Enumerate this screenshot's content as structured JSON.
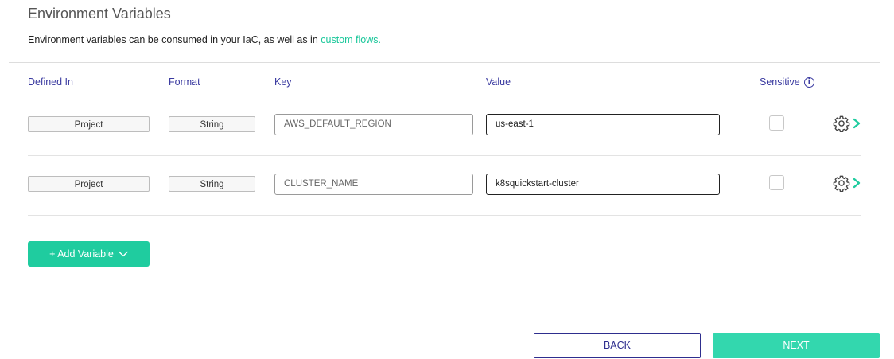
{
  "section": {
    "title": "Environment Variables",
    "description": "Environment variables can be consumed in your IaC, as well as in",
    "link_text": "custom flows."
  },
  "table": {
    "headers": {
      "defined_in": "Defined In",
      "format": "Format",
      "key": "Key",
      "value": "Value",
      "sensitive": "Sensitive"
    },
    "rows": [
      {
        "defined_in": "Project",
        "format": "String",
        "key": "AWS_DEFAULT_REGION",
        "value": "us-east-1",
        "sensitive": false
      },
      {
        "defined_in": "Project",
        "format": "String",
        "key": "CLUSTER_NAME",
        "value": "k8squickstart-cluster",
        "sensitive": false
      }
    ]
  },
  "actions": {
    "add_variable": "+ Add Variable",
    "back": "BACK",
    "next": "NEXT"
  },
  "icons": {
    "info": "info-icon",
    "settings": "gear-icon",
    "expand": "chevron-right-icon",
    "dropdown": "chevron-down-icon"
  },
  "colors": {
    "accent": "#1fcc9f",
    "header_text": "#3a3aa0",
    "back_border": "#2e2e8e"
  }
}
